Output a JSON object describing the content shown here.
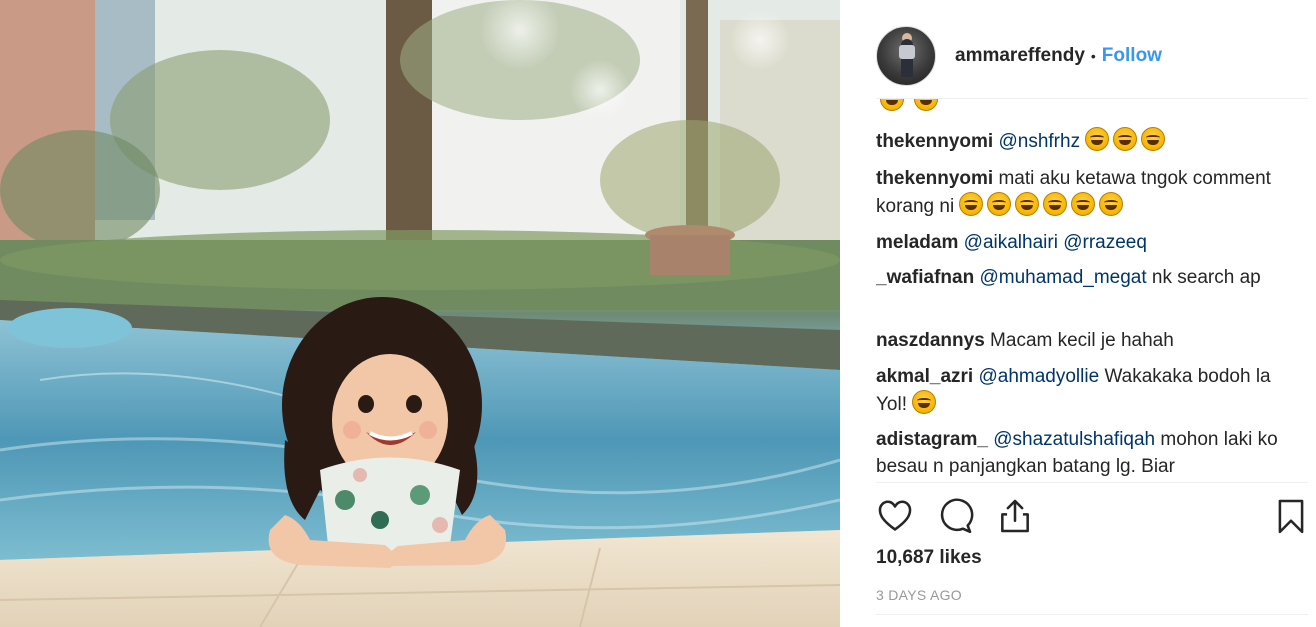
{
  "post": {
    "photo": {
      "description_icon": "photo-of-girl-in-pool-icon"
    },
    "header": {
      "username": "ammareffendy",
      "separator": "•",
      "follow_label": "Follow"
    },
    "comments": [
      {
        "user": "thekennyomi",
        "mention": "@nshfrhz",
        "text": "",
        "emoji_count": 3
      },
      {
        "user": "thekennyomi",
        "mention": "",
        "text": "mati aku ketawa tngok comment korang ni",
        "emoji_count": 6
      },
      {
        "user": "meladam",
        "mention": "@aikalhairi @rrazeeq",
        "text": "",
        "emoji_count": 0
      },
      {
        "user": "_wafiafnan",
        "mention": "@muhamad_megat",
        "text": "nk search ap",
        "emoji_count": 0
      },
      {
        "user": "naszdannys",
        "mention": "",
        "text": "Macam kecil je hahah",
        "emoji_count": 0
      },
      {
        "user": "akmal_azri",
        "mention": "@ahmadyollie",
        "text": "Wakakaka bodoh la Yol!",
        "emoji_count": 1
      },
      {
        "user": "adistagram_",
        "mention": "@shazatulshafiqah",
        "text": "mohon laki ko besau n panjangkan batang lg. Biar",
        "emoji_count": 0
      }
    ],
    "actions": {
      "like_icon": "heart-icon",
      "comment_icon": "comment-bubble-icon",
      "share_icon": "share-icon",
      "save_icon": "bookmark-icon"
    },
    "likes": "10,687 likes",
    "timestamp": "3 DAYS AGO",
    "colors": {
      "link_blue": "#3897f0",
      "mention_blue": "#003569",
      "text": "#262626",
      "muted": "#999999"
    }
  }
}
